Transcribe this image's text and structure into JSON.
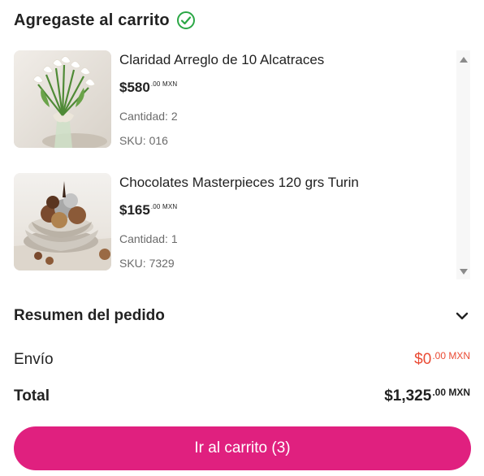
{
  "header": {
    "title": "Agregaste al carrito",
    "icon": "check-circle-icon",
    "icon_color": "#2aa745"
  },
  "cart_items": [
    {
      "name": "Claridad Arreglo de 10 Alcatraces",
      "price": "$580",
      "price_cents": ".00 MXN",
      "quantity": "Cantidad: 2",
      "sku": "SKU: 016",
      "image": "calla-lilies-vase-image"
    },
    {
      "name": "Chocolates Masterpieces 120 grs Turin",
      "price": "$165",
      "price_cents": ".00 MXN",
      "quantity": "Cantidad: 1",
      "sku": "SKU: 7329",
      "image": "chocolates-bowl-image"
    }
  ],
  "summary": {
    "title": "Resumen del pedido",
    "shipping_label": "Envío",
    "shipping_value": "$0",
    "shipping_cents": ".00 MXN",
    "total_label": "Total",
    "total_value": "$1,325",
    "total_cents": ".00 MXN"
  },
  "cta": {
    "label": "Ir al carrito (3)",
    "color": "#e0207f"
  },
  "colors": {
    "accent": "#e0207f",
    "shipping_free": "#ea4b34"
  }
}
